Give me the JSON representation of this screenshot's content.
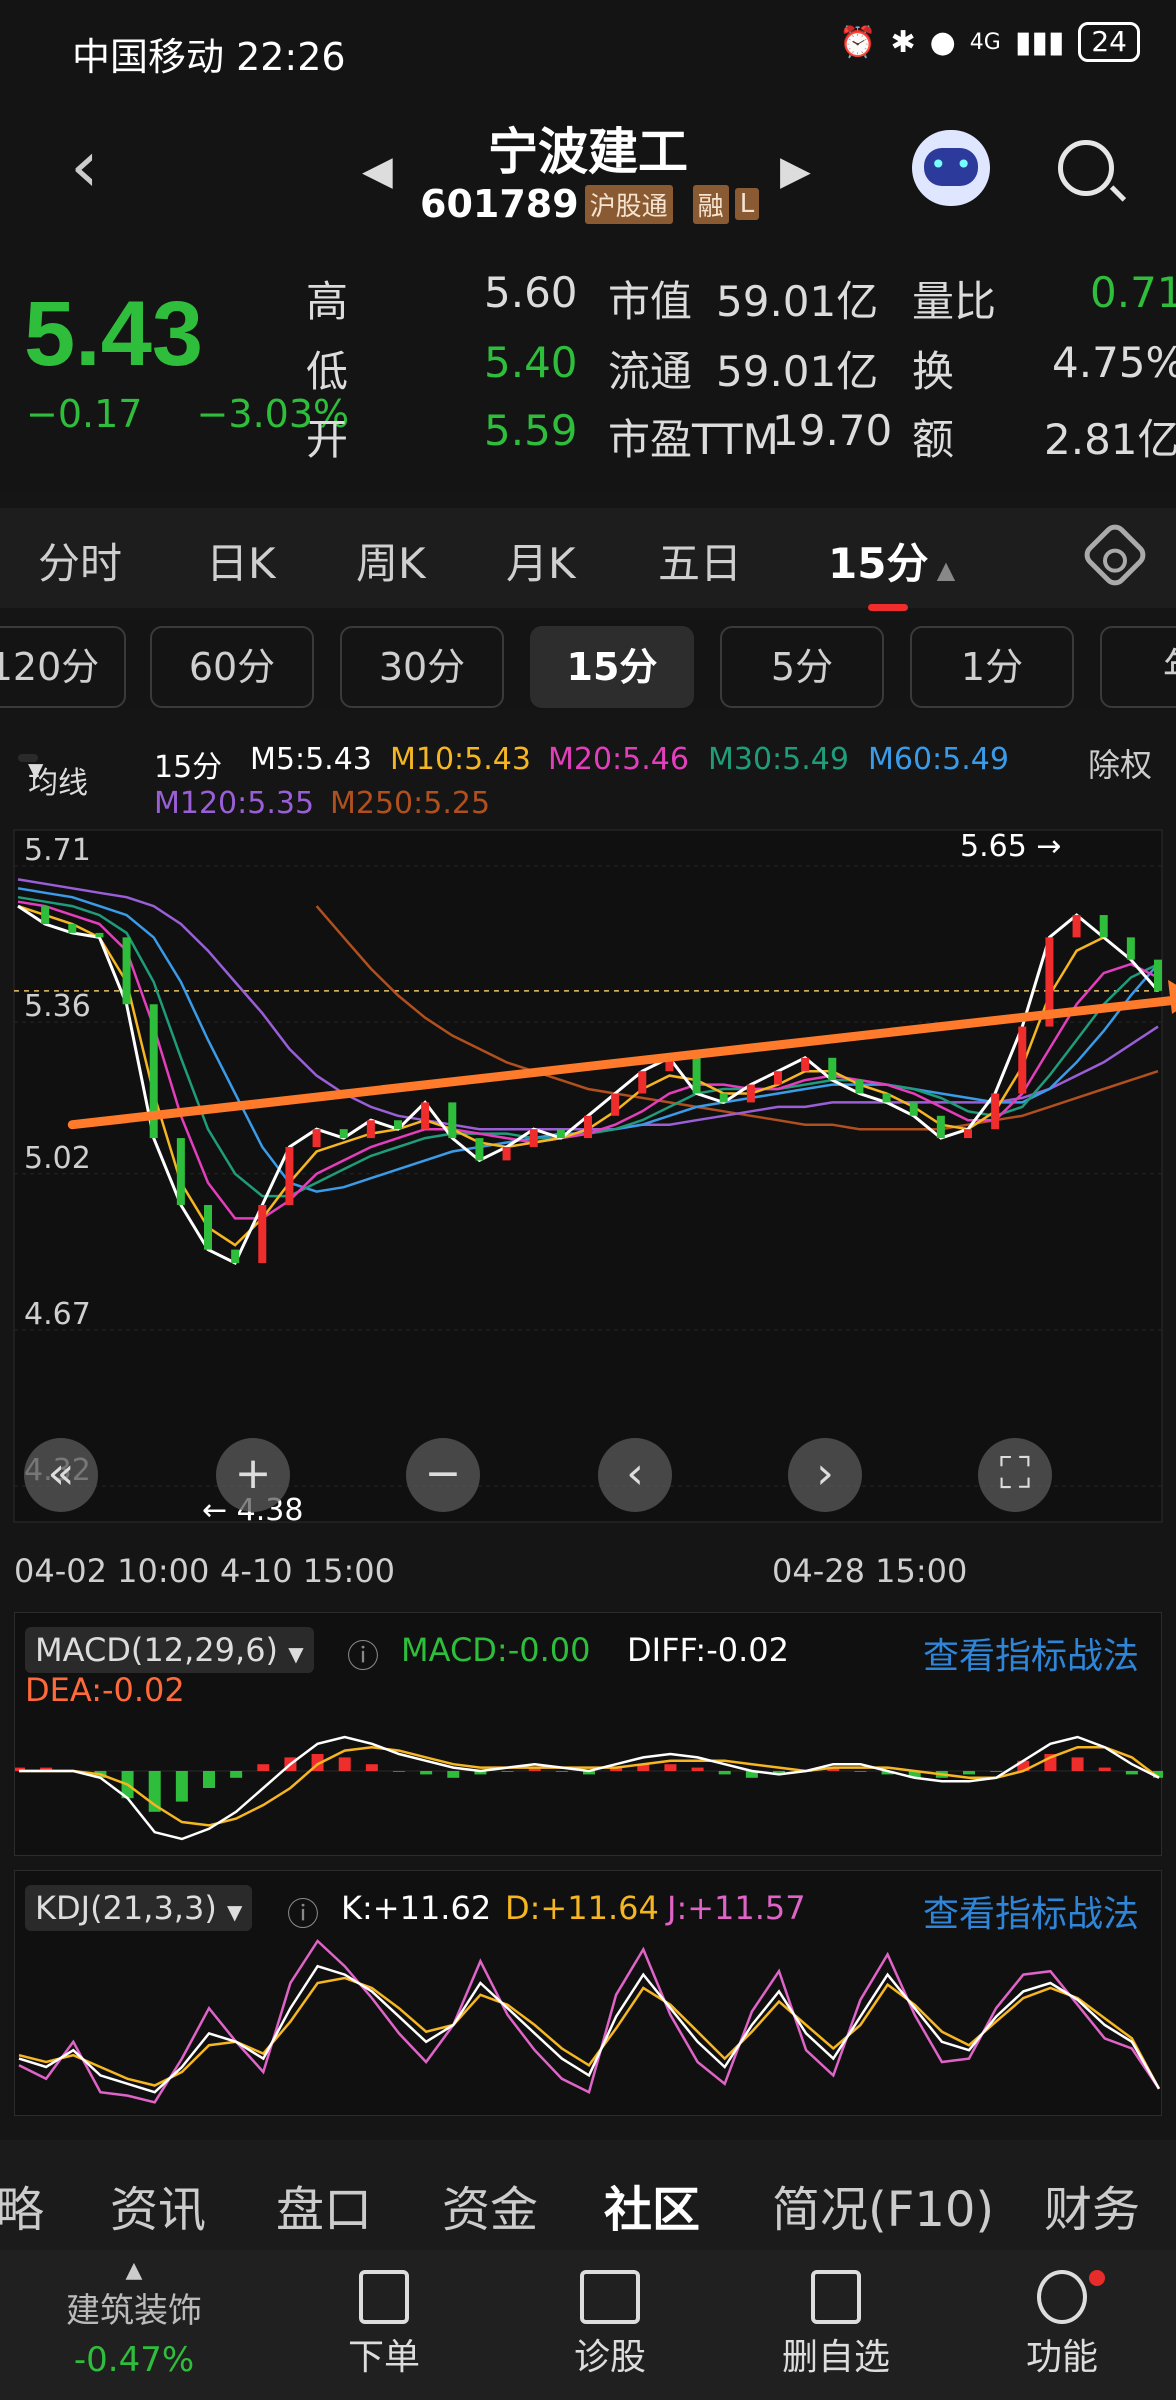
{
  "status_bar": {
    "carrier_time": "中国移动 22:26",
    "network": "4G",
    "battery": "24"
  },
  "header": {
    "back_icon": "back-chevron-icon",
    "stock_name": "宁波建工",
    "stock_code": "601789",
    "tags": [
      "沪股通",
      "融",
      "L"
    ]
  },
  "quote": {
    "price": "5.43",
    "change": "−0.17",
    "change_pct": "−3.03%",
    "rows": [
      {
        "k1": "高",
        "v1": "5.60",
        "k2": "市值",
        "v2": "59.01亿",
        "k3": "量比",
        "v3": "0.71"
      },
      {
        "k1": "低",
        "v1": "5.40",
        "k2": "流通",
        "v2": "59.01亿",
        "k3": "换",
        "v3": "4.75%"
      },
      {
        "k1": "开",
        "v1": "5.59",
        "k2": "市盈TTM",
        "v2": "19.70",
        "k3": "额",
        "v3": "2.81亿"
      }
    ]
  },
  "period_tabs": [
    "分时",
    "日K",
    "周K",
    "月K",
    "五日",
    "15分"
  ],
  "active_period": "15分",
  "sub_periods": [
    "120分",
    "60分",
    "30分",
    "15分",
    "5分",
    "1分",
    "年"
  ],
  "ma_legend": {
    "dropdown": "均线",
    "period": "15分",
    "items": [
      {
        "label": "M5:5.43",
        "color": "#ffffff"
      },
      {
        "label": "M10:5.43",
        "color": "#f5b622"
      },
      {
        "label": "M20:5.46",
        "color": "#e33fbd"
      },
      {
        "label": "M30:5.49",
        "color": "#1f9c7a"
      },
      {
        "label": "M60:5.49",
        "color": "#3a9be8"
      },
      {
        "label": "M120:5.35",
        "color": "#9a5fd6"
      },
      {
        "label": "M250:5.25",
        "color": "#b0501f"
      }
    ],
    "right_label": "除权"
  },
  "chart_data": {
    "type": "line",
    "title": "",
    "y_ticks": [
      "5.71",
      "5.36",
      "5.02",
      "4.67",
      "4.32"
    ],
    "ylim": [
      4.32,
      5.71
    ],
    "x_labels": [
      "04-02 10:00",
      "4-10 15:00",
      "04-28 15:00"
    ],
    "annotations": [
      {
        "text": "5.65",
        "note": "high"
      },
      {
        "text": "4.38",
        "note": "low"
      }
    ],
    "series": [
      {
        "values": [
          5.62,
          5.58,
          5.56,
          5.55,
          5.4,
          5.1,
          4.95,
          4.85,
          4.82,
          4.95,
          5.08,
          5.12,
          5.1,
          5.14,
          5.12,
          5.18,
          5.1,
          5.05,
          5.08,
          5.12,
          5.1,
          5.15,
          5.2,
          5.25,
          5.28,
          5.2,
          5.18,
          5.22,
          5.25,
          5.28,
          5.23,
          5.2,
          5.18,
          5.15,
          5.1,
          5.12,
          5.2,
          5.35,
          5.55,
          5.6,
          5.55,
          5.5,
          5.43
        ]
      },
      {
        "values": [
          5.62,
          5.6,
          5.58,
          5.55,
          5.45,
          5.2,
          5.0,
          4.9,
          4.86,
          4.92,
          5.0,
          5.07,
          5.09,
          5.11,
          5.12,
          5.14,
          5.12,
          5.09,
          5.08,
          5.09,
          5.1,
          5.12,
          5.16,
          5.21,
          5.24,
          5.23,
          5.2,
          5.2,
          5.22,
          5.25,
          5.25,
          5.22,
          5.2,
          5.17,
          5.13,
          5.12,
          5.16,
          5.26,
          5.42,
          5.52,
          5.55,
          5.5,
          5.43
        ]
      },
      {
        "values": [
          5.63,
          5.62,
          5.6,
          5.58,
          5.52,
          5.35,
          5.15,
          5.0,
          4.92,
          4.92,
          4.96,
          5.02,
          5.05,
          5.08,
          5.1,
          5.12,
          5.12,
          5.11,
          5.1,
          5.09,
          5.1,
          5.11,
          5.13,
          5.16,
          5.2,
          5.22,
          5.22,
          5.21,
          5.21,
          5.23,
          5.24,
          5.23,
          5.22,
          5.2,
          5.17,
          5.14,
          5.14,
          5.2,
          5.3,
          5.4,
          5.47,
          5.49,
          5.46
        ]
      },
      {
        "values": [
          5.64,
          5.63,
          5.62,
          5.6,
          5.56,
          5.45,
          5.28,
          5.12,
          5.02,
          4.97,
          4.97,
          5.0,
          5.03,
          5.06,
          5.08,
          5.1,
          5.11,
          5.11,
          5.11,
          5.1,
          5.1,
          5.11,
          5.12,
          5.14,
          5.17,
          5.2,
          5.21,
          5.21,
          5.21,
          5.22,
          5.23,
          5.23,
          5.22,
          5.21,
          5.19,
          5.16,
          5.15,
          5.17,
          5.24,
          5.32,
          5.4,
          5.46,
          5.49
        ]
      },
      {
        "values": [
          5.66,
          5.65,
          5.64,
          5.62,
          5.6,
          5.55,
          5.45,
          5.32,
          5.2,
          5.08,
          5.0,
          4.98,
          4.99,
          5.01,
          5.03,
          5.05,
          5.07,
          5.08,
          5.09,
          5.1,
          5.11,
          5.11,
          5.12,
          5.13,
          5.15,
          5.17,
          5.18,
          5.19,
          5.2,
          5.21,
          5.22,
          5.22,
          5.22,
          5.21,
          5.2,
          5.19,
          5.18,
          5.18,
          5.21,
          5.27,
          5.34,
          5.42,
          5.49
        ]
      },
      {
        "values": [
          5.68,
          5.67,
          5.66,
          5.65,
          5.64,
          5.62,
          5.58,
          5.52,
          5.45,
          5.38,
          5.3,
          5.24,
          5.2,
          5.17,
          5.15,
          5.14,
          5.13,
          5.12,
          5.12,
          5.12,
          5.12,
          5.12,
          5.12,
          5.13,
          5.13,
          5.14,
          5.15,
          5.16,
          5.17,
          5.17,
          5.18,
          5.18,
          5.18,
          5.18,
          5.18,
          5.18,
          5.18,
          5.19,
          5.21,
          5.24,
          5.27,
          5.31,
          5.35
        ]
      },
      {
        "values": [
          null,
          null,
          null,
          null,
          null,
          null,
          null,
          null,
          null,
          null,
          null,
          5.62,
          5.55,
          5.48,
          5.42,
          5.37,
          5.33,
          5.3,
          5.27,
          5.25,
          5.23,
          5.21,
          5.2,
          5.19,
          5.18,
          5.17,
          5.16,
          5.15,
          5.14,
          5.13,
          5.13,
          5.12,
          5.12,
          5.12,
          5.12,
          5.13,
          5.14,
          5.15,
          5.17,
          5.19,
          5.21,
          5.23,
          5.25
        ]
      }
    ],
    "trendline": {
      "from": [
        2,
        5.13
      ],
      "to": [
        42,
        5.41
      ]
    }
  },
  "chart_tools": [
    "double-left-icon",
    "zoom-in-icon",
    "zoom-out-icon",
    "left-icon",
    "right-icon",
    "fullscreen-icon"
  ],
  "macd": {
    "name": "MACD(12,29,6)",
    "macd": "MACD:-0.00",
    "diff": "DIFF:-0.02",
    "dea": "DEA:-0.02",
    "link": "查看指标战法",
    "chart_data": {
      "type": "bar",
      "values": [
        0.01,
        0.01,
        0.0,
        -0.02,
        -0.08,
        -0.12,
        -0.09,
        -0.05,
        -0.02,
        0.02,
        0.04,
        0.05,
        0.04,
        0.02,
        0.0,
        -0.01,
        -0.02,
        -0.01,
        0.0,
        0.01,
        0.0,
        -0.01,
        0.01,
        0.02,
        0.02,
        0.01,
        -0.01,
        -0.02,
        -0.01,
        0.0,
        0.01,
        0.0,
        -0.01,
        -0.02,
        -0.02,
        -0.01,
        0.0,
        0.03,
        0.05,
        0.04,
        0.01,
        -0.01,
        -0.02
      ],
      "diff": [
        0.0,
        0.0,
        0.0,
        -0.02,
        -0.08,
        -0.18,
        -0.2,
        -0.17,
        -0.12,
        -0.05,
        0.02,
        0.08,
        0.1,
        0.08,
        0.05,
        0.03,
        0.01,
        0.0,
        0.01,
        0.02,
        0.01,
        0.0,
        0.02,
        0.04,
        0.05,
        0.04,
        0.02,
        0.0,
        -0.01,
        0.0,
        0.02,
        0.02,
        0.0,
        -0.02,
        -0.03,
        -0.03,
        -0.02,
        0.03,
        0.08,
        0.1,
        0.07,
        0.02,
        -0.02
      ],
      "dea": [
        0.0,
        0.0,
        0.0,
        -0.01,
        -0.04,
        -0.1,
        -0.15,
        -0.16,
        -0.14,
        -0.1,
        -0.05,
        0.02,
        0.06,
        0.07,
        0.06,
        0.04,
        0.02,
        0.01,
        0.01,
        0.01,
        0.01,
        0.01,
        0.01,
        0.02,
        0.03,
        0.03,
        0.03,
        0.02,
        0.01,
        0.0,
        0.01,
        0.01,
        0.01,
        0.0,
        -0.01,
        -0.02,
        -0.02,
        0.0,
        0.04,
        0.07,
        0.07,
        0.04,
        -0.02
      ]
    }
  },
  "kdj": {
    "name": "KDJ(21,3,3)",
    "k": "K:+11.62",
    "d": "D:+11.64",
    "j": "J:+11.57",
    "link": "查看指标战法",
    "chart_data": {
      "type": "line",
      "k": [
        30,
        25,
        35,
        20,
        15,
        10,
        25,
        45,
        40,
        30,
        60,
        85,
        80,
        70,
        55,
        40,
        50,
        75,
        60,
        45,
        30,
        20,
        55,
        80,
        60,
        40,
        25,
        50,
        70,
        45,
        30,
        55,
        80,
        60,
        40,
        35,
        55,
        70,
        75,
        65,
        50,
        40,
        12
      ],
      "d": [
        32,
        28,
        32,
        25,
        18,
        14,
        22,
        38,
        40,
        33,
        52,
        75,
        78,
        72,
        60,
        46,
        50,
        68,
        62,
        50,
        36,
        26,
        48,
        72,
        62,
        46,
        30,
        46,
        64,
        50,
        36,
        50,
        74,
        62,
        46,
        38,
        52,
        66,
        72,
        66,
        54,
        42,
        12
      ],
      "j": [
        26,
        18,
        40,
        10,
        8,
        4,
        30,
        60,
        40,
        22,
        75,
        100,
        85,
        66,
        45,
        28,
        50,
        88,
        56,
        35,
        18,
        10,
        68,
        95,
        56,
        28,
        15,
        58,
        82,
        35,
        20,
        65,
        92,
        56,
        28,
        30,
        60,
        80,
        82,
        62,
        42,
        36,
        12
      ]
    }
  },
  "bottom_tabs": [
    "略",
    "资讯",
    "盘口",
    "资金",
    "社区",
    "简况(F10)",
    "财务"
  ],
  "active_bottom_tab": "社区",
  "dock": {
    "sector_name": "建筑装饰",
    "sector_change": "-0.47%",
    "items": [
      {
        "label": "下单",
        "icon": "order-icon"
      },
      {
        "label": "诊股",
        "icon": "diagnose-icon"
      },
      {
        "label": "删自选",
        "icon": "remove-watchlist-icon"
      },
      {
        "label": "功能",
        "icon": "menu-icon"
      }
    ]
  },
  "colors": {
    "up": "#ef2d2d",
    "down": "#2fbe3b",
    "trend": "#ff7a2a",
    "link": "#2f86d9"
  }
}
